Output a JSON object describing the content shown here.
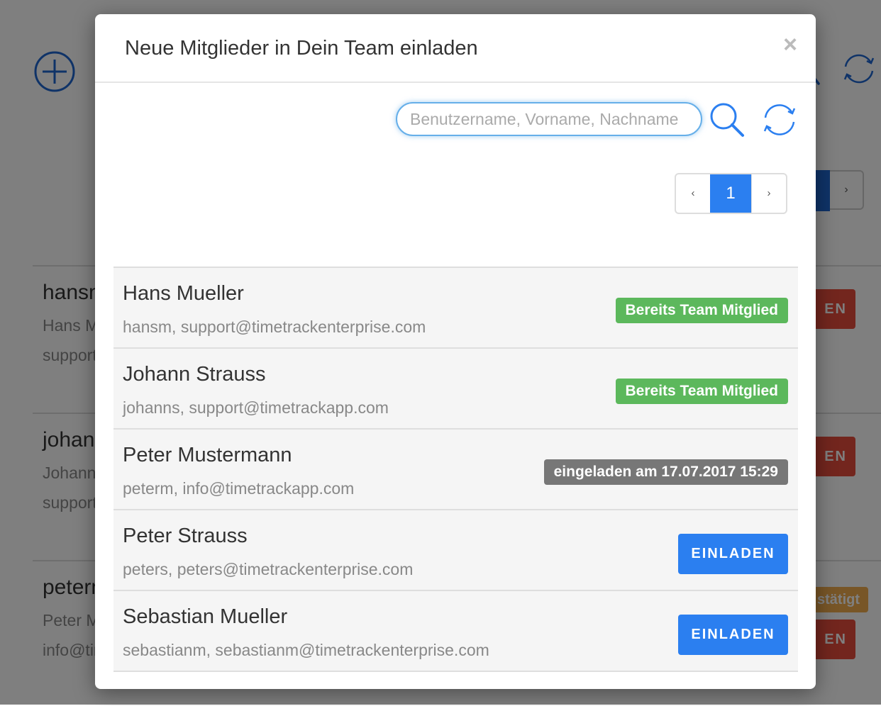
{
  "colors": {
    "accent": "#2b7ff0",
    "success": "#5cb85c",
    "muted_badge": "#777777",
    "danger": "#e74c3c",
    "warning": "#f0ad4e",
    "overlay": "rgba(0,0,0,0.5)"
  },
  "background": {
    "add_icon": "plus-circle-icon",
    "refresh_icon": "refresh-icon",
    "pager_next_label": "›",
    "rows": [
      {
        "username": "hansm",
        "fullname": "Hans Mueller",
        "email": "support@timetrackenterprise.com",
        "button_label": "EN"
      },
      {
        "username": "johanns",
        "fullname": "Johann Strauss",
        "email": "support@timetrackapp.com",
        "button_label": "EN"
      },
      {
        "username": "peterm",
        "fullname": "Peter Mustermann",
        "email": "info@timetrackapp.com",
        "status_label": "stätigt",
        "button_label": "EN"
      }
    ]
  },
  "modal": {
    "title": "Neue Mitglieder in Dein Team einladen",
    "close_label": "×",
    "search": {
      "placeholder": "Benutzername, Vorname, Nachname",
      "value": "",
      "search_icon": "search-icon",
      "refresh_icon": "refresh-icon"
    },
    "pagination": {
      "prev_label": "‹",
      "current_page": "1",
      "next_label": "›"
    },
    "users": [
      {
        "name": "Hans Mueller",
        "details": "hansm, support@timetrackenterprise.com",
        "status": "Bereits Team Mitglied",
        "status_type": "member"
      },
      {
        "name": "Johann Strauss",
        "details": "johanns, support@timetrackapp.com",
        "status": "Bereits Team Mitglied",
        "status_type": "member"
      },
      {
        "name": "Peter Mustermann",
        "details": "peterm, info@timetrackapp.com",
        "status": "eingeladen am 17.07.2017 15:29",
        "status_type": "invited"
      },
      {
        "name": "Peter Strauss",
        "details": "peters, peters@timetrackenterprise.com",
        "action": "EINLADEN",
        "status_type": "none"
      },
      {
        "name": "Sebastian Mueller",
        "details": "sebastianm, sebastianm@timetrackenterprise.com",
        "action": "EINLADEN",
        "status_type": "none"
      }
    ]
  }
}
